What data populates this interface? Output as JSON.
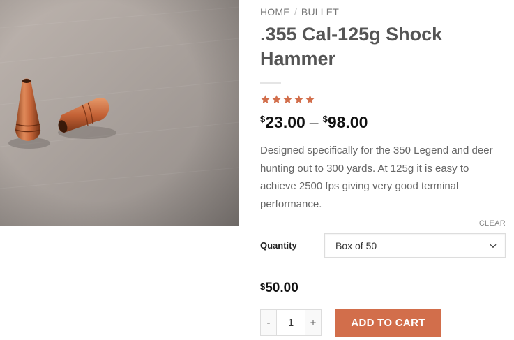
{
  "breadcrumb": {
    "home": "HOME",
    "separator": "/",
    "category": "BULLET"
  },
  "product": {
    "title": ".355 Cal-125g Shock Hammer",
    "rating": 5,
    "rating_max": 5,
    "price_min_symbol": "$",
    "price_min": "23.00",
    "price_dash": "–",
    "price_max_symbol": "$",
    "price_max": "98.00",
    "description": "Designed specifically for the 350 Legend and deer hunting out to 300 yards.  At 125g it is easy to achieve 2500 fps giving very good terminal performance."
  },
  "variation": {
    "clear_label": "CLEAR",
    "quantity_label": "Quantity",
    "selected_option": "Box of 50",
    "price_symbol": "$",
    "price": "50.00"
  },
  "cart": {
    "minus_label": "-",
    "quantity": "1",
    "plus_label": "+",
    "add_to_cart_label": "ADD TO CART"
  },
  "colors": {
    "accent": "#d26e4b",
    "text": "#555555",
    "price": "#111111",
    "copper": "#c8673a"
  },
  "icons": {
    "star": "star-icon",
    "chevron": "chevron-down-icon"
  }
}
